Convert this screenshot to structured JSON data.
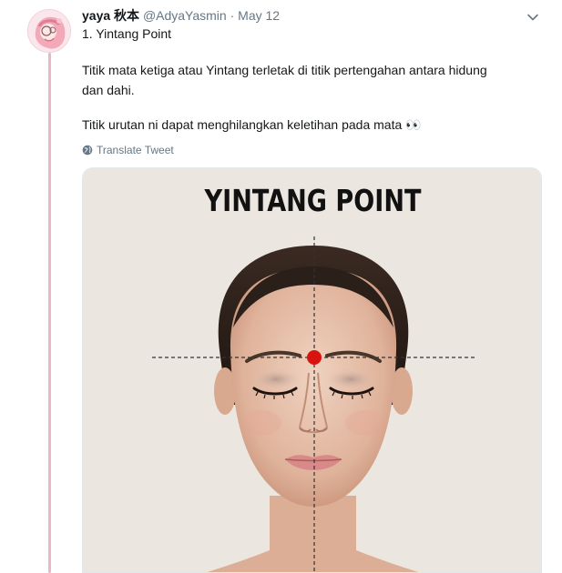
{
  "tweet": {
    "display_name": "yaya 秋本",
    "handle": "@AdyaYasmin",
    "separator": "·",
    "date": "May 12",
    "title": "1. Yintang Point",
    "paragraph1": "Titik mata ketiga atau Yintang terletak di titik pertengahan antara hidung dan dahi.",
    "paragraph2": "Titik urutan ni dapat menghilangkan keletihan pada mata",
    "paragraph2_emoji": "👀",
    "translate_label": "Translate Tweet"
  },
  "media": {
    "heading": "YINTANG POINT",
    "point_color": "#d9140f"
  },
  "icons": {
    "caret": "chevron-down-icon",
    "translate": "globe-icon",
    "avatar": "avatar-illustration"
  },
  "colors": {
    "thread_line": "#e8b8c4",
    "secondary_text": "#657786",
    "media_background": "#ece6e1"
  }
}
